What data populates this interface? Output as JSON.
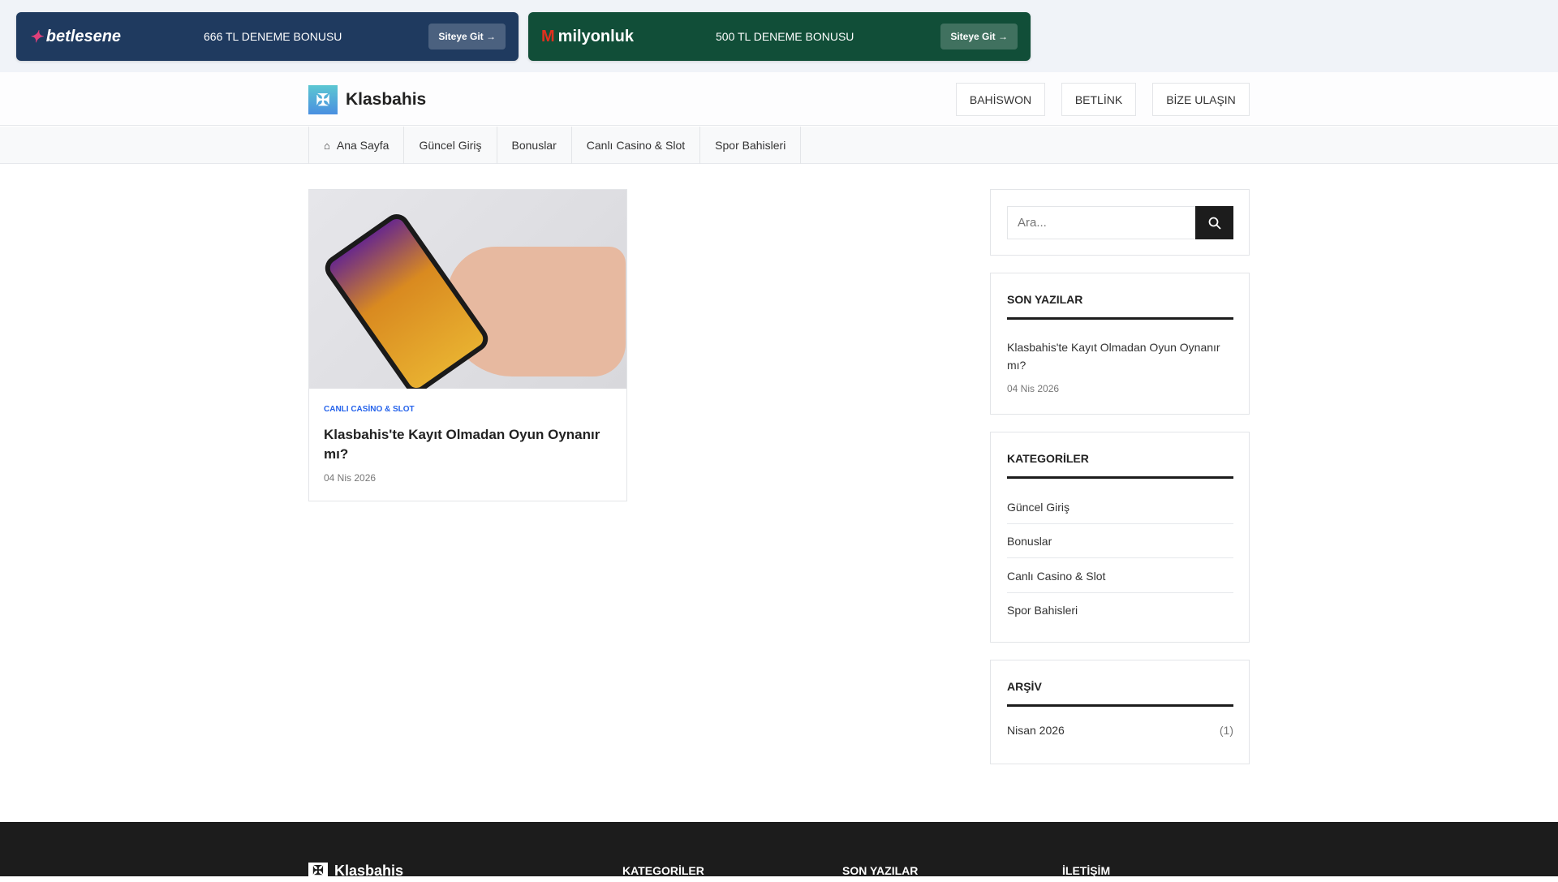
{
  "promos": [
    {
      "brand": "betlesene",
      "text": "666 TL DENEME BONUSU",
      "button": "Siteye Git →",
      "color": "#1f3a5f"
    },
    {
      "brand": "milyonluk",
      "text": "500 TL DENEME BONUSU",
      "button": "Siteye Git →",
      "color": "#114e38"
    }
  ],
  "header": {
    "site_name": "Klasbahis",
    "buttons": [
      "BAHİSWON",
      "BETLİNK",
      "BİZE ULAŞIN"
    ]
  },
  "nav": [
    "Ana Sayfa",
    "Güncel Giriş",
    "Bonuslar",
    "Canlı Casino & Slot",
    "Spor Bahisleri"
  ],
  "post": {
    "category": "CANLI CASİNO & SLOT",
    "title": "Klasbahis'te Kayıt Olmadan Oyun Oynanır mı?",
    "date": "04 Nis 2026"
  },
  "sidebar": {
    "search_placeholder": "Ara...",
    "recent_title": "SON YAZILAR",
    "recent": [
      {
        "title": "Klasbahis'te Kayıt Olmadan Oyun Oynanır mı?",
        "date": "04 Nis 2026"
      }
    ],
    "categories_title": "KATEGORİLER",
    "categories": [
      "Güncel Giriş",
      "Bonuslar",
      "Canlı Casino & Slot",
      "Spor Bahisleri"
    ],
    "archive_title": "ARŞİV",
    "archive": [
      {
        "label": "Nisan 2026",
        "count": "(1)"
      }
    ]
  },
  "footer": {
    "site_name": "Klasbahis",
    "headings": [
      "KATEGORİLER",
      "SON YAZILAR",
      "İLETİŞİM"
    ]
  }
}
